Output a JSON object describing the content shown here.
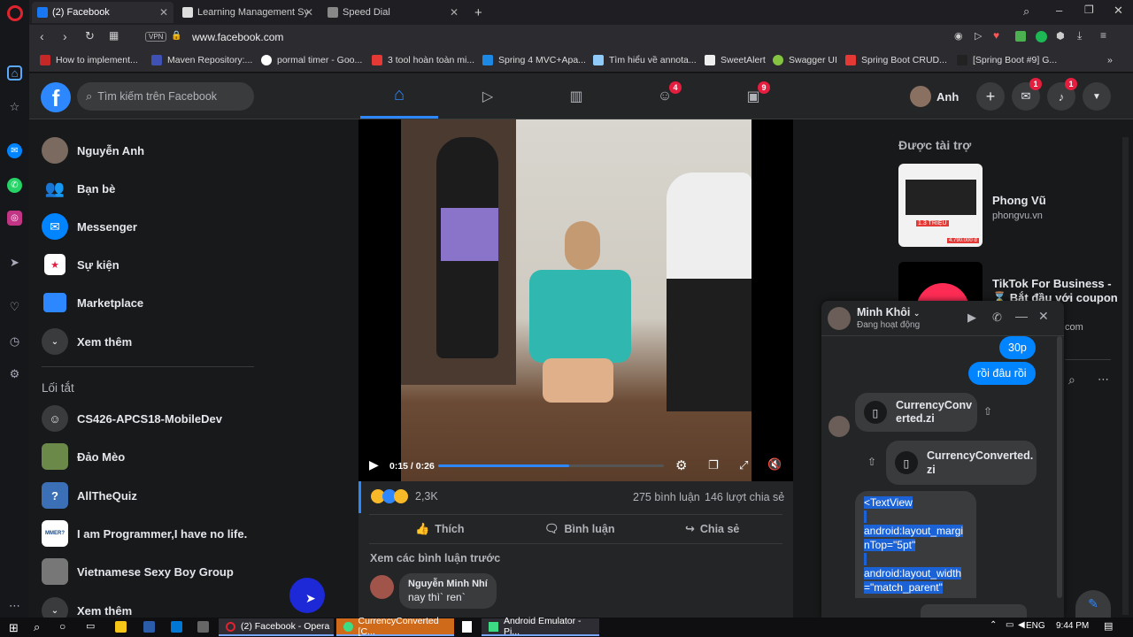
{
  "browser": {
    "tabs": [
      {
        "title": "(2) Facebook",
        "active": true
      },
      {
        "title": "Learning Management Syst",
        "active": false
      },
      {
        "title": "Speed Dial",
        "active": false
      }
    ],
    "new_tab": "+",
    "vpn": "VPN",
    "url": "www.facebook.com",
    "bookmarks": [
      "How to implement...",
      "Maven Repository:...",
      "pormal timer - Goo...",
      "3 tool hoàn toàn mi...",
      "Spring 4 MVC+Apa...",
      "Tìm hiểu về annota...",
      "SweetAlert",
      "Swagger UI",
      "Spring Boot CRUD...",
      "[Spring Boot #9] G..."
    ]
  },
  "facebook": {
    "search_placeholder": "Tìm kiếm trên Facebook",
    "nav_badges": {
      "groups": "4",
      "gaming": "9"
    },
    "profile_name": "Anh",
    "top_badges": {
      "messenger": "1",
      "notifications": "1"
    },
    "left_nav": [
      {
        "label": "Nguyễn Anh"
      },
      {
        "label": "Bạn bè"
      },
      {
        "label": "Messenger"
      },
      {
        "label": "Sự kiện"
      },
      {
        "label": "Marketplace"
      },
      {
        "label": "Xem thêm"
      }
    ],
    "shortcuts_title": "Lối tắt",
    "shortcuts": [
      {
        "label": "CS426-APCS18-MobileDev"
      },
      {
        "label": "Đảo Mèo"
      },
      {
        "label": "AllTheQuiz"
      },
      {
        "label": "I am Programmer,I have no life."
      },
      {
        "label": "Vietnamese Sexy Boy Group"
      },
      {
        "label": "Xem thêm"
      }
    ],
    "video": {
      "time": "0:15 / 0:26",
      "progress": 0.58
    },
    "reactions_count": "2,3K",
    "comments_count": "275 bình luận",
    "shares_count": "146 lượt chia sẻ",
    "actions": {
      "like": "Thích",
      "comment": "Bình luận",
      "share": "Chia sẻ"
    },
    "see_previous": "Xem các bình luận trước",
    "comment": {
      "author": "Nguyễn Minh Nhí",
      "text": "nay thì` ren`"
    },
    "sponsored_title": "Được tài trợ",
    "ads": [
      {
        "title": "Phong Vũ",
        "domain": "phongvu.vn",
        "badge": "1.3 TRIỆU",
        "price": "4.790.000 đ"
      },
      {
        "title": "TikTok For Business -",
        "subtitle": "⌛ Bắt đầu với coupon",
        "domain": "com"
      }
    ]
  },
  "chat": {
    "name": "Minh Khôi",
    "status": "Đang hoạt động",
    "messages": {
      "me1": "30p",
      "me2": "rồi đâu rồi",
      "file1": "CurrencyConverted.zi",
      "file1_line1": "CurrencyConv",
      "file1_line2": "erted.zi",
      "file2_line1": "CurrencyConverted.",
      "file2_line2": "zi",
      "code_lines": [
        "<TextView",
        "android:layout_margi",
        "nTop=\"5pt\"",
        "android:layout_width",
        "=\"match_parent\""
      ]
    }
  },
  "taskbar": {
    "apps": [
      "(2) Facebook - Opera",
      "CurrencyConverted [C...",
      "Android Emulator - Pi..."
    ],
    "lang": "ENG",
    "time": "9:44 PM"
  },
  "colors": {
    "accent": "#2d88ff",
    "badge": "#e41e3f",
    "messenger_blue": "#0084ff"
  }
}
